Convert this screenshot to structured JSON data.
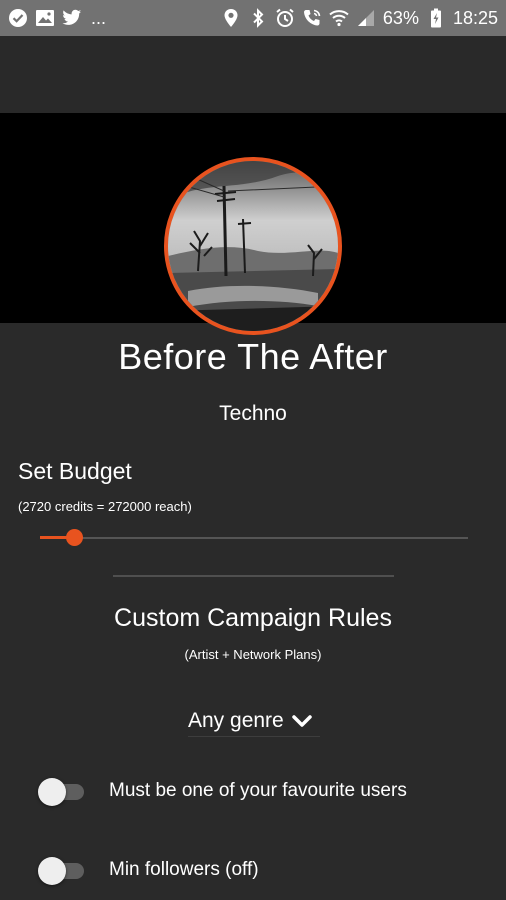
{
  "status_bar": {
    "battery_percent": "63%",
    "time": "18:25",
    "more": "...",
    "left_icons": [
      "check-circle-icon",
      "image-icon",
      "twitter-icon"
    ],
    "right_icons": [
      "location-icon",
      "bluetooth-icon",
      "alarm-icon",
      "wifi-call-icon",
      "wifi-icon",
      "signal-icon",
      "battery-icon"
    ]
  },
  "profile": {
    "artist_name": "Before The After",
    "genre": "Techno"
  },
  "budget": {
    "title": "Set Budget",
    "summary": "(2720 credits = 272000 reach)",
    "slider_fraction": 0.08
  },
  "campaign_rules": {
    "title": "Custom Campaign Rules",
    "subtitle": "(Artist + Network Plans)",
    "genre_select": "Any genre",
    "rules": [
      {
        "label": "Must be one of your favourite users",
        "on": false
      },
      {
        "label": "Min followers (off)",
        "on": false
      }
    ]
  },
  "colors": {
    "accent": "#e8531f",
    "background": "#2a2a2a",
    "header_band": "#000000",
    "status_bar": "#727272"
  }
}
